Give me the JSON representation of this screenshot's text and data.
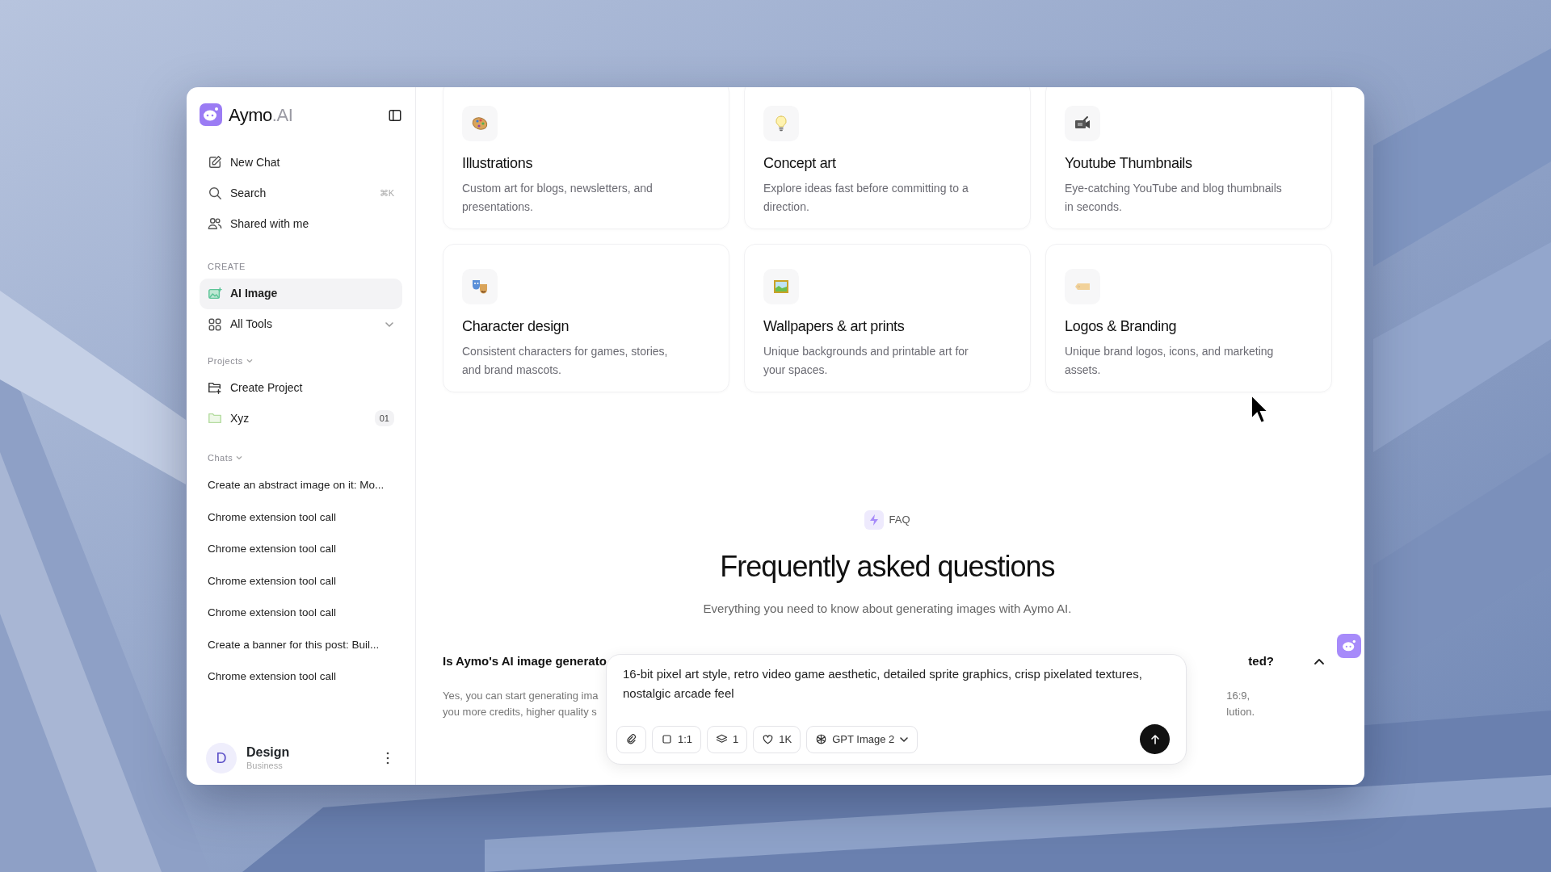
{
  "brand": {
    "name": "Aymo",
    "suffix": ".AI"
  },
  "nav": [
    {
      "label": "New Chat"
    },
    {
      "label": "Search",
      "shortcut": "⌘K"
    },
    {
      "label": "Shared with me"
    }
  ],
  "create": {
    "heading": "CREATE",
    "items": [
      {
        "label": "AI Image",
        "selected": true,
        "expandable": false
      },
      {
        "label": "All Tools",
        "selected": false,
        "expandable": true
      }
    ]
  },
  "projects": {
    "heading": "Projects",
    "items": [
      {
        "label": "Create Project"
      },
      {
        "label": "Xyz",
        "count": "01"
      }
    ]
  },
  "chats": {
    "heading": "Chats",
    "items": [
      "Create an abstract image on it: Mo...",
      "Chrome extension tool call",
      "Chrome extension tool call",
      "Chrome extension tool call",
      "Chrome extension tool call",
      "Create a banner for this post: Buil...",
      "Chrome extension tool call"
    ]
  },
  "user": {
    "initial": "D",
    "name": "Design",
    "plan": "Business"
  },
  "cards": [
    {
      "title": "Illustrations",
      "desc": "Custom art for blogs, newsletters, and presentations."
    },
    {
      "title": "Concept art",
      "desc": "Explore ideas fast before committing to a direction."
    },
    {
      "title": "Youtube Thumbnails",
      "desc": "Eye-catching YouTube and blog thumbnails in seconds."
    },
    {
      "title": "Character design",
      "desc": "Consistent characters for games, stories, and brand mascots."
    },
    {
      "title": "Wallpapers & art prints",
      "desc": "Unique backgrounds and printable art for your spaces."
    },
    {
      "title": "Logos & Branding",
      "desc": "Unique brand logos, icons, and marketing assets."
    }
  ],
  "faq": {
    "badge": "FAQ",
    "title": "Frequently asked questions",
    "subtitle": "Everything you need to know about generating images with Aymo AI.",
    "item": {
      "question_left": "Is Aymo's AI image generato",
      "question_right": "ted?",
      "expanded": true,
      "answer_left": [
        "Yes, you can start generating ima",
        "you more credits, higher quality s"
      ],
      "answer_right": [
        "16:9,",
        "lution."
      ]
    }
  },
  "composer": {
    "value": "16-bit pixel art style, retro video game aesthetic, detailed sprite graphics, crisp pixelated textures, nostalgic arcade feel",
    "chips": [
      {
        "kind": "attach"
      },
      {
        "kind": "ratio",
        "label": "1:1"
      },
      {
        "kind": "count",
        "label": "1"
      },
      {
        "kind": "quality",
        "label": "1K"
      },
      {
        "kind": "model",
        "label": "GPT Image 2"
      }
    ]
  }
}
